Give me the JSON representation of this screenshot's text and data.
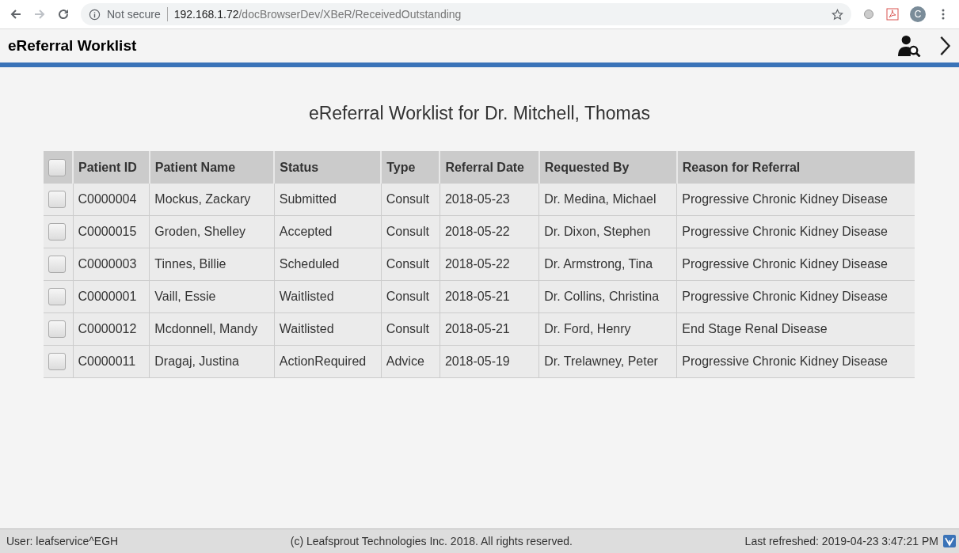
{
  "browser": {
    "security": "Not secure",
    "url_host": "192.168.1.72",
    "url_path": "/docBrowserDev/XBeR/ReceivedOutstanding",
    "profile_initial": "C"
  },
  "app": {
    "title": "eReferral Worklist"
  },
  "page": {
    "heading": "eReferral Worklist for Dr. Mitchell, Thomas"
  },
  "table": {
    "select_all_checked": false,
    "columns": [
      "Patient ID",
      "Patient Name",
      "Status",
      "Type",
      "Referral Date",
      "Requested By",
      "Reason for Referral"
    ],
    "rows": [
      {
        "checked": false,
        "cells": [
          "C0000004",
          "Mockus, Zackary",
          "Submitted",
          "Consult",
          "2018-05-23",
          "Dr. Medina, Michael",
          "Progressive Chronic Kidney Disease"
        ]
      },
      {
        "checked": false,
        "cells": [
          "C0000015",
          "Groden, Shelley",
          "Accepted",
          "Consult",
          "2018-05-22",
          "Dr. Dixon, Stephen",
          "Progressive Chronic Kidney Disease"
        ]
      },
      {
        "checked": false,
        "cells": [
          "C0000003",
          "Tinnes, Billie",
          "Scheduled",
          "Consult",
          "2018-05-22",
          "Dr. Armstrong, Tina",
          "Progressive Chronic Kidney Disease"
        ]
      },
      {
        "checked": false,
        "cells": [
          "C0000001",
          "Vaill, Essie",
          "Waitlisted",
          "Consult",
          "2018-05-21",
          "Dr. Collins, Christina",
          "Progressive Chronic Kidney Disease"
        ]
      },
      {
        "checked": false,
        "cells": [
          "C0000012",
          "Mcdonnell, Mandy",
          "Waitlisted",
          "Consult",
          "2018-05-21",
          "Dr. Ford, Henry",
          "End Stage Renal Disease"
        ]
      },
      {
        "checked": false,
        "cells": [
          "C0000011",
          "Dragaj, Justina",
          "ActionRequired",
          "Advice",
          "2018-05-19",
          "Dr. Trelawney, Peter",
          "Progressive Chronic Kidney Disease"
        ]
      }
    ]
  },
  "status_bar": {
    "user": "User: leafservice^EGH",
    "copyright": "(c) Leafsprout Technologies Inc. 2018. All rights reserved.",
    "refreshed": "Last refreshed: 2019-04-23 3:47:21 PM"
  }
}
